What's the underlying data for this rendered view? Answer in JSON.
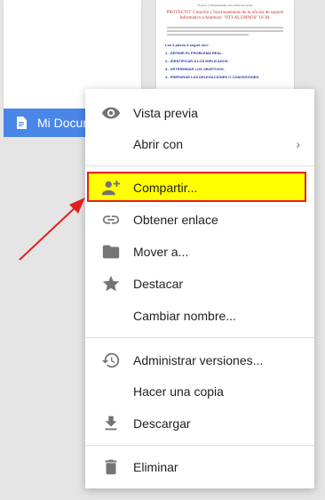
{
  "files": {
    "blank_chip_label": "Mi Documento sin titulo",
    "preview": {
      "header": "Proyecto y Funcionamiento de la oficina de soporte",
      "title": "PROYECTO\" Creación y funcionamiento de la oficina de soporte Informático a Alumnos: \"OTI-ALUMNOS\" UCM.",
      "subheading": "Los 6 pasos a seguir son:",
      "steps": [
        "1.- DEFINIR EL PROBLEMA REAL.",
        "2.- IDENTIFICAR A LOS IMPLICADOS.",
        "3.- DETERMINAR LOS OBJETIVOS.",
        "4.- PREPARAR LAS DELEGACIONES O CONCESIONES."
      ]
    }
  },
  "menu": {
    "items": [
      {
        "label": "Vista previa",
        "icon": "eye-icon"
      },
      {
        "label": "Abrir con",
        "icon": "",
        "chevron": "›"
      },
      {
        "label": "Compartir...",
        "icon": "person-add-icon"
      },
      {
        "label": "Obtener enlace",
        "icon": "link-icon"
      },
      {
        "label": "Mover a...",
        "icon": "folder-icon"
      },
      {
        "label": "Destacar",
        "icon": "star-icon"
      },
      {
        "label": "Cambiar nombre...",
        "icon": ""
      },
      {
        "label": "Administrar versiones...",
        "icon": "history-icon"
      },
      {
        "label": "Hacer una copia",
        "icon": ""
      },
      {
        "label": "Descargar",
        "icon": "download-icon"
      },
      {
        "label": "Eliminar",
        "icon": "trash-icon"
      }
    ]
  },
  "annotation": {
    "highlight_color": "#ffff00",
    "border_color": "#e02020",
    "arrow_color": "#e02020"
  }
}
